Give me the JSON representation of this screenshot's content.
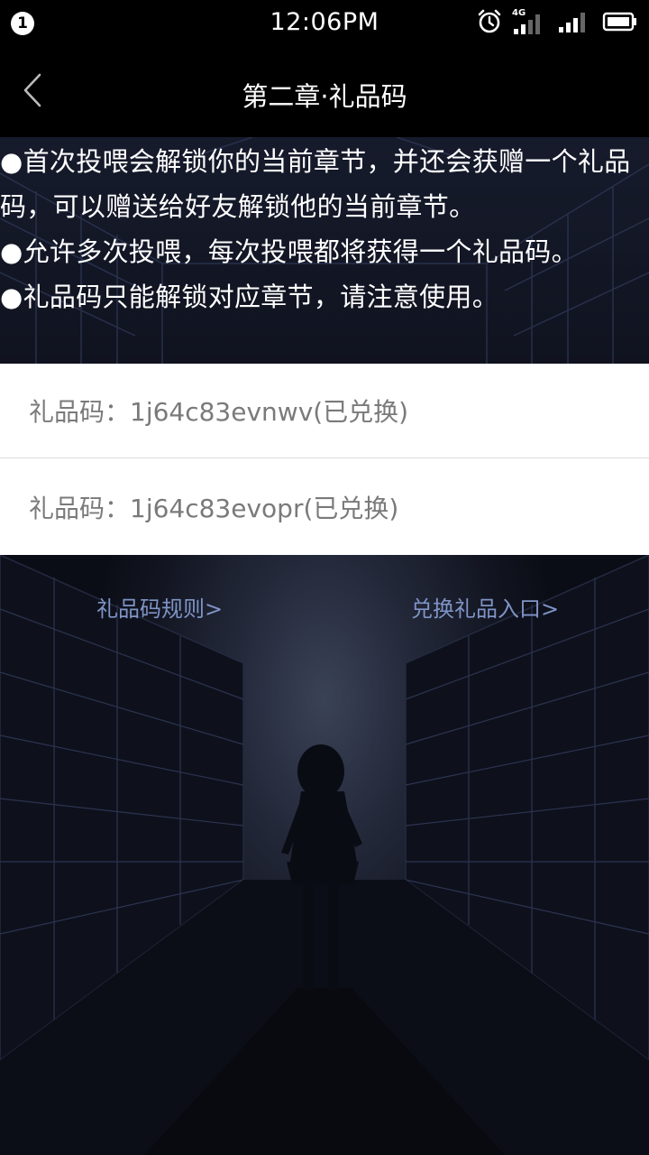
{
  "status_bar": {
    "notification_count": "1",
    "time": "12:06PM",
    "network": "4G"
  },
  "header": {
    "title": "第二章·礼品码"
  },
  "info": {
    "lines": [
      "●首次投喂会解锁你的当前章节，并还会获赠一个礼品码，可以赠送给好友解锁他的当前章节。",
      "●允许多次投喂，每次投喂都将获得一个礼品码。",
      "●礼品码只能解锁对应章节，请注意使用。"
    ]
  },
  "codes": [
    {
      "text": "礼品码：1j64c83evnwv(已兑换)"
    },
    {
      "text": "礼品码：1j64c83evopr(已兑换)"
    }
  ],
  "links": {
    "rules": "礼品码规则>",
    "redeem": "兑换礼品入口>"
  },
  "colors": {
    "link": "#7f94c6",
    "code_text": "#7a7a7a",
    "header_bg": "#000000"
  }
}
